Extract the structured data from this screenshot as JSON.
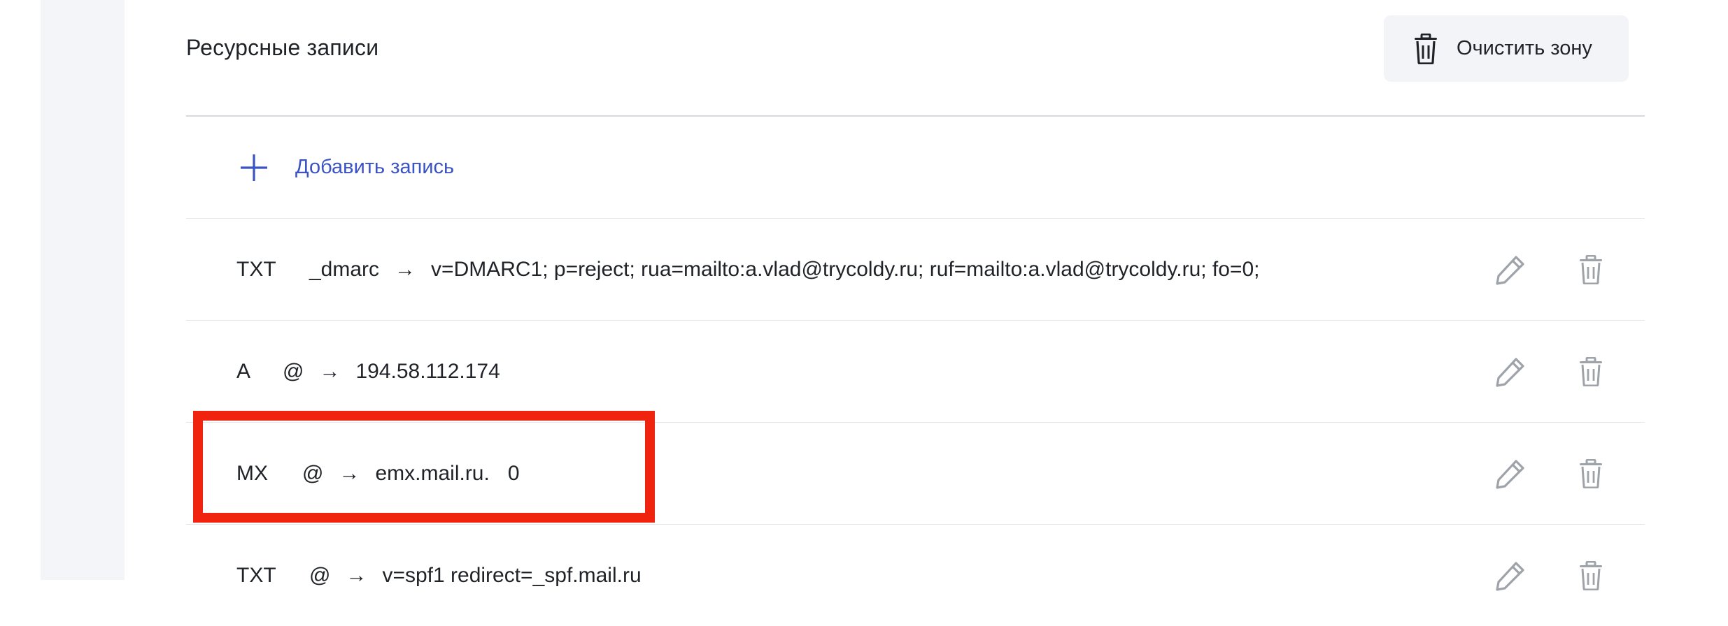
{
  "header": {
    "title": "Ресурсные записи",
    "clear_zone_label": "Очистить зону"
  },
  "add_record": {
    "label": "Добавить запись"
  },
  "records": [
    {
      "type": "TXT",
      "name": "_dmarc",
      "arrow": "→",
      "value": "v=DMARC1; p=reject; rua=mailto:a.vlad@trycoldy.ru; ruf=mailto:a.vlad@trycoldy.ru; fo=0;",
      "priority": ""
    },
    {
      "type": "A",
      "name": "@",
      "arrow": "→",
      "value": "194.58.112.174",
      "priority": ""
    },
    {
      "type": "MX",
      "name": "@",
      "arrow": "→",
      "value": "emx.mail.ru.",
      "priority": "0"
    },
    {
      "type": "TXT",
      "name": "@",
      "arrow": "→",
      "value": "v=spf1 redirect=_spf.mail.ru",
      "priority": ""
    }
  ],
  "colors": {
    "accent": "#3b53c4",
    "highlight": "#f0230f",
    "icon_gray": "#9ea3aa",
    "button_bg": "#f2f4f7"
  },
  "icons": {
    "clear_zone": "trash-icon",
    "add": "plus-icon",
    "edit": "pencil-icon",
    "delete": "trash-icon"
  }
}
